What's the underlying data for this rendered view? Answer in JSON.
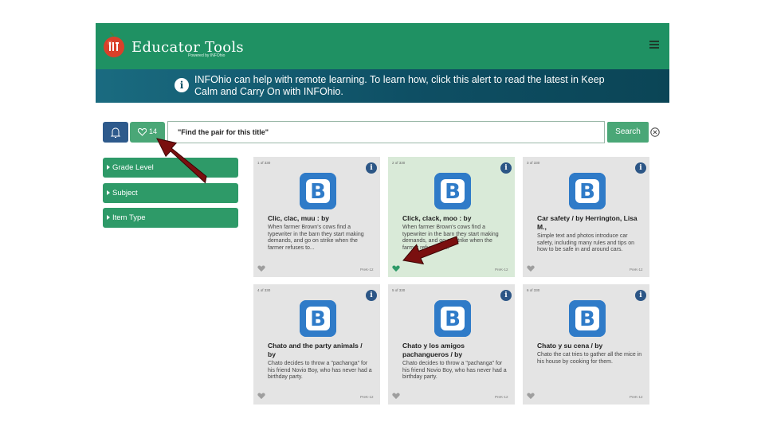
{
  "header": {
    "title": "Educator Tools",
    "subtitle": "Powered by INFOhio"
  },
  "alert": {
    "text": "INFOhio can help with remote learning. To learn how, click this alert to read the latest in Keep Calm and Carry On with INFOhio."
  },
  "toolbar": {
    "favorites_count": "14",
    "search_value": "\"Find the pair for this title\"",
    "search_label": "Search"
  },
  "filters": [
    {
      "label": "Grade Level"
    },
    {
      "label": "Subject"
    },
    {
      "label": "Item Type"
    }
  ],
  "results": [
    {
      "position": "1 of 330",
      "title": "Clic, clac, muu : by",
      "description": "When farmer Brown's cows find a typewriter in the barn they start making demands, and go on strike when the farmer refuses to...",
      "grade": "PreK-12",
      "favorited": false
    },
    {
      "position": "2 of 330",
      "title": "Click, clack, moo : by",
      "description": "When farmer Brown's cows find a typewriter in the barn they start making demands, and go on strike when the farmer refuses to...",
      "grade": "PreK-12",
      "favorited": true
    },
    {
      "position": "3 of 330",
      "title": "Car safety / by Herrington, Lisa M.,",
      "description": "Simple text and photos introduce car safety, including many rules and tips on how to be safe in and around cars.",
      "grade": "PreK-12",
      "favorited": false
    },
    {
      "position": "4 of 330",
      "title": "Chato and the party animals / by",
      "description": "Chato decides to throw a \"pachanga\" for his friend Novio Boy, who has never had a birthday party.",
      "grade": "PreK-12",
      "favorited": false
    },
    {
      "position": "5 of 330",
      "title": "Chato y los amigos pachangueros / by",
      "description": "Chato decides to throw a \"pachanga\" for his friend Novio Boy, who has never had a birthday party.",
      "grade": "PreK-12",
      "favorited": false
    },
    {
      "position": "6 of 330",
      "title": "Chato y su cena / by",
      "description": "Chato the cat tries to gather all the mice in his house by cooking for them.",
      "grade": "PreK-12",
      "favorited": false
    }
  ],
  "colors": {
    "header_green": "#1f9163",
    "alert_teal": "#0e4f64",
    "button_green": "#4aa777",
    "bell_blue": "#2e5a8c",
    "card_gray": "#e4e4e4",
    "favorited_card": "#d9ead8",
    "arrow": "#7a0f0f"
  },
  "icons": [
    "apple-logo-icon",
    "menu-icon",
    "info-icon",
    "bell-icon",
    "heart-icon",
    "close-circle-icon",
    "caret-right-icon",
    "b-logo-icon"
  ]
}
